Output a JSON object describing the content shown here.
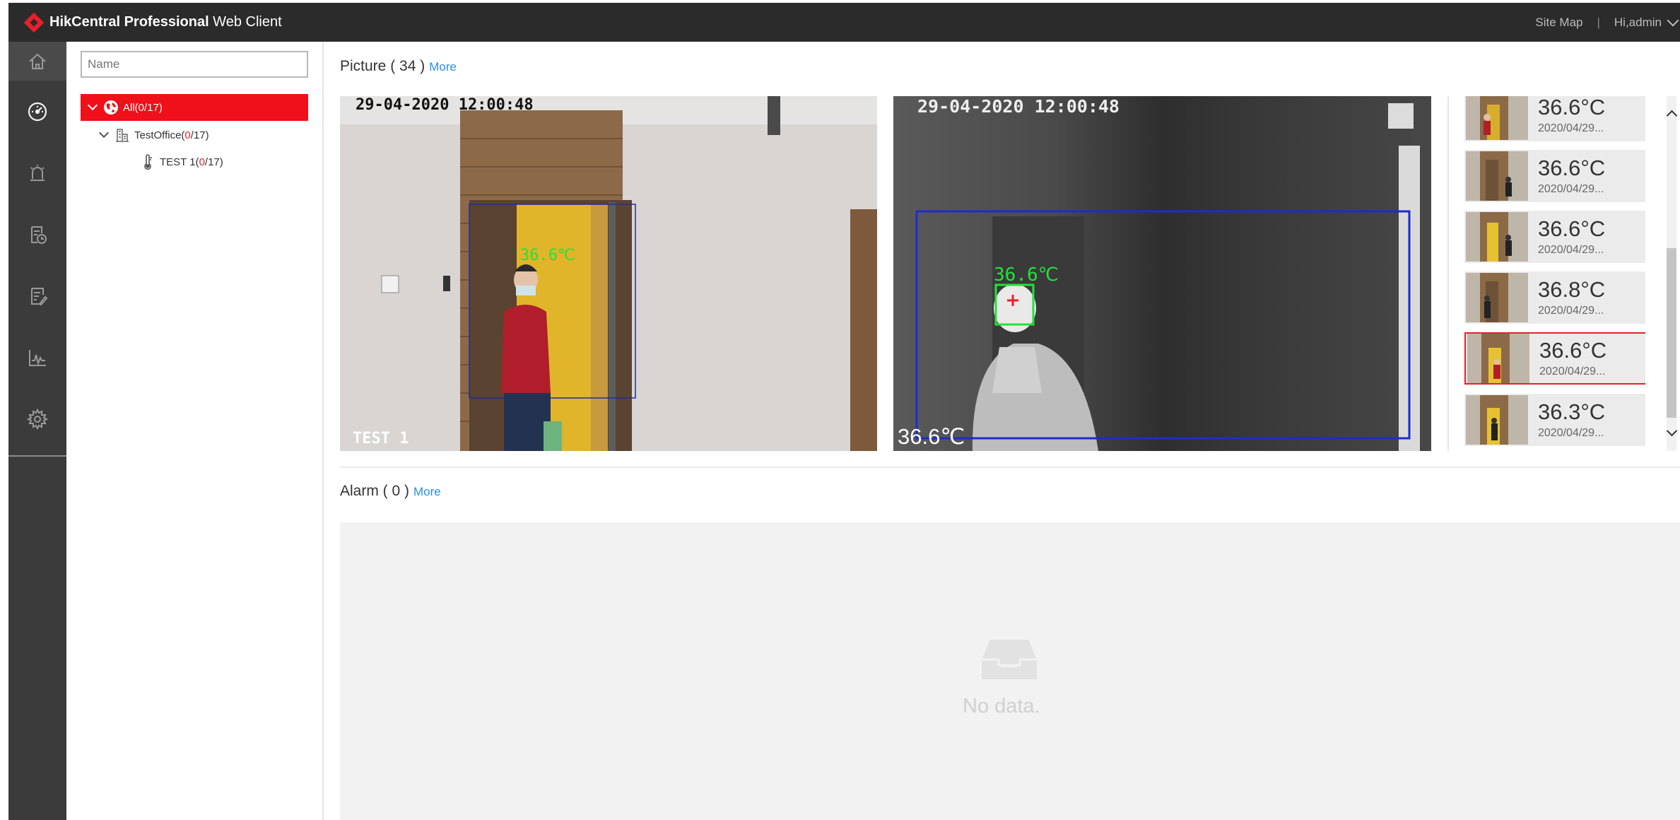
{
  "header": {
    "brand_bold": "HikCentral Professional",
    "brand_rest": " Web Client",
    "site_map": "Site Map",
    "user": "Hi,admin"
  },
  "nav": {
    "items": [
      "home-icon",
      "dashboard-icon",
      "alarm-icon",
      "event-schedule-icon",
      "report-icon",
      "statistics-icon",
      "settings-icon"
    ]
  },
  "tree": {
    "search_placeholder": "Name",
    "root": {
      "label": "All",
      "open": "(",
      "online": "0",
      "sep": "/",
      "total": "17",
      "close": ")"
    },
    "group": {
      "label": "TestOffice",
      "open": "(",
      "online": "0",
      "sep": "/",
      "total": "17",
      "close": ")"
    },
    "device": {
      "label": "TEST 1",
      "open": "(",
      "online": "0",
      "sep": "/",
      "total": "17",
      "close": ")"
    }
  },
  "picture": {
    "title": "Picture ( 34 )",
    "more": "More",
    "visible": {
      "timestamp": "29-04-2020 12:00:48",
      "camera_name": "TEST 1",
      "temp_overlay": "36.6℃"
    },
    "thermal": {
      "timestamp": "29-04-2020 12:00:48",
      "temp_overlay": "36.6℃",
      "temp_corner": "36.6℃"
    },
    "thumbnails": [
      {
        "temp": "36.6°C",
        "time": "2020/04/29..."
      },
      {
        "temp": "36.6°C",
        "time": "2020/04/29..."
      },
      {
        "temp": "36.6°C",
        "time": "2020/04/29..."
      },
      {
        "temp": "36.8°C",
        "time": "2020/04/29..."
      },
      {
        "temp": "36.6°C",
        "time": "2020/04/29..."
      },
      {
        "temp": "36.3°C",
        "time": "2020/04/29..."
      }
    ]
  },
  "alarm": {
    "title": "Alarm ( 0 )",
    "more": "More",
    "empty_text": "No data."
  },
  "colors": {
    "accent": "#e8202a",
    "link": "#2a8ee6",
    "topbar": "#2b2b2b",
    "nav": "#3b3b3b"
  }
}
